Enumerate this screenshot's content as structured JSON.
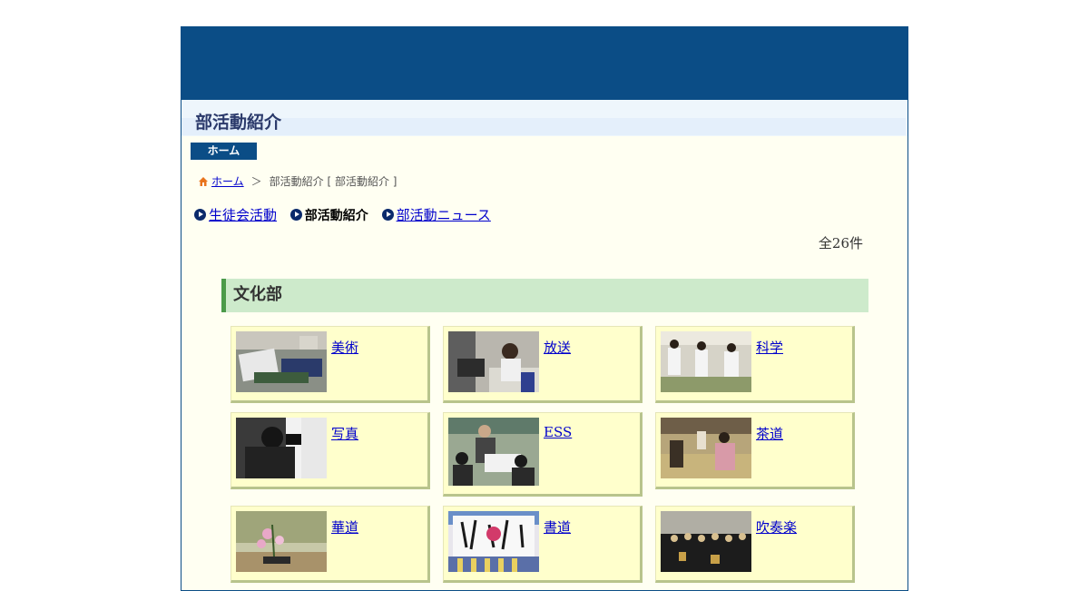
{
  "page": {
    "title": "部活動紹介",
    "home_button": "ホーム"
  },
  "breadcrumb": {
    "home": "ホーム",
    "separator": "＞",
    "current": "部活動紹介 [ 部活動紹介 ]"
  },
  "nav": {
    "items": [
      {
        "label": "生徒会活動",
        "active": false
      },
      {
        "label": "部活動紹介",
        "active": true
      },
      {
        "label": "部活動ニュース",
        "active": false
      }
    ]
  },
  "count_label": "全26件",
  "section": {
    "title": "文化部",
    "clubs": [
      {
        "name": "美術",
        "photo": "art-photo"
      },
      {
        "name": "放送",
        "photo": "broadcast-photo"
      },
      {
        "name": "科学",
        "photo": "science-photo"
      },
      {
        "name": "写真",
        "photo": "photography-photo"
      },
      {
        "name": "ESS",
        "photo": "ess-photo"
      },
      {
        "name": "茶道",
        "photo": "tea-ceremony-photo"
      },
      {
        "name": "華道",
        "photo": "flower-arrangement-photo"
      },
      {
        "name": "書道",
        "photo": "calligraphy-photo"
      },
      {
        "name": "吹奏楽",
        "photo": "brass-band-photo"
      }
    ]
  },
  "colors": {
    "banner": "#0b4d86",
    "section_head": "#cdeacb",
    "card": "#ffffcc",
    "link": "#0000cc"
  }
}
